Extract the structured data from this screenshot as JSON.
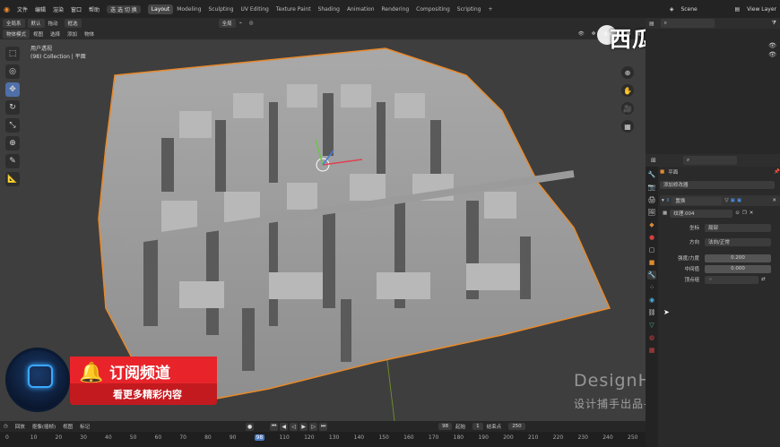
{
  "topbar": {
    "menus": [
      "文件",
      "编辑",
      "渲染",
      "窗口",
      "帮助"
    ],
    "mode_button": "迭 选 切 换",
    "workspaces": [
      "Layout",
      "Modeling",
      "Sculpting",
      "UV Editing",
      "Texture Paint",
      "Shading",
      "Animation",
      "Rendering",
      "Compositing",
      "Scripting"
    ],
    "scene": "Scene",
    "view_layer": "View Layer"
  },
  "header2": {
    "coord": "全局系",
    "pivot": "默认",
    "drag": "拖动",
    "select": "框选",
    "transform": "全局"
  },
  "header3": {
    "mode": "物体模式",
    "view": "视图",
    "select": "选择",
    "add": "添加",
    "object": "物体"
  },
  "viewport": {
    "perspective": "用户透视",
    "collection": "(98) Collection | 平面"
  },
  "watermark": {
    "text": "西瓜视频"
  },
  "subscribe": {
    "title": "订阅频道",
    "desc": "看更多精彩内容"
  },
  "brand": {
    "name": "DesignHunting",
    "subtitle": "设计捕手出品-基础部分"
  },
  "timeline": {
    "mode": "回放",
    "keying": "抠像(插帧)",
    "view": "视图",
    "marker": "标记",
    "current_frame": "98",
    "start_label": "起始",
    "start": "1",
    "end_label": "结束点",
    "end": "250",
    "ticks": [
      "0",
      "10",
      "20",
      "30",
      "40",
      "50",
      "60",
      "70",
      "80",
      "90",
      "98",
      "110",
      "120",
      "130",
      "140",
      "150",
      "160",
      "170",
      "180",
      "190",
      "200",
      "210",
      "220",
      "230",
      "240",
      "250"
    ]
  },
  "properties": {
    "object_name": "平面",
    "add_modifier": "添加修改器",
    "modifier_name": "置换",
    "texture": "纹理.004",
    "coords_label": "坐标",
    "coords_value": "局部",
    "direction_label": "方向",
    "direction_value": "法向/正常",
    "strength_label": "强度/力度",
    "strength_value": "0.200",
    "midlevel_label": "中间值",
    "midlevel_value": "0.000",
    "vgroup_label": "顶点组"
  },
  "colors": {
    "accent": "#4a78c2",
    "selection_outline": "#e8892a",
    "subscribe_red": "#e8242a"
  }
}
